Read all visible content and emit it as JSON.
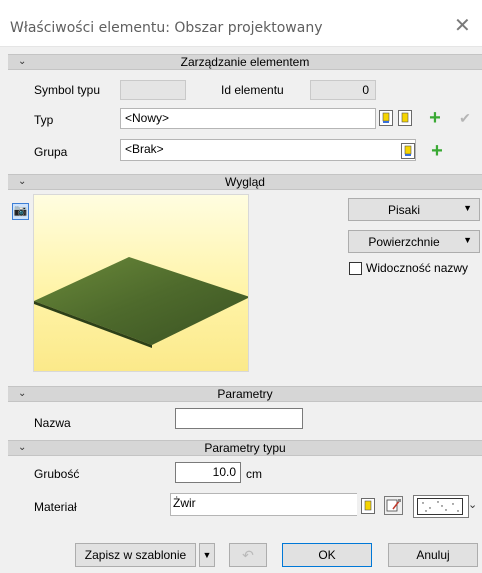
{
  "window": {
    "title": "Właściwości elementu: Obszar projektowany",
    "close_icon": "close-icon"
  },
  "sections": {
    "zarzadzanie": "Zarządzanie elementem",
    "wyglad": "Wygląd",
    "parametry": "Parametry",
    "parametry_typu": "Parametry typu"
  },
  "element": {
    "symbol_label": "Symbol typu",
    "symbol_value": "",
    "id_label": "Id elementu",
    "id_value": "0",
    "typ_label": "Typ",
    "typ_value": "<Nowy>",
    "grupa_label": "Grupa",
    "grupa_value": "<Brak>"
  },
  "wyglad": {
    "pisaki_label": "Pisaki",
    "powierzchnie_label": "Powierzchnie",
    "widocznosc_label": "Widoczność nazwy",
    "widocznosc_checked": false
  },
  "parametry": {
    "nazwa_label": "Nazwa",
    "nazwa_value": ""
  },
  "parametry_typu": {
    "grubosc_label": "Grubość",
    "grubosc_value": "10.0",
    "grubosc_unit": "cm",
    "material_label": "Materiał",
    "material_value": "Żwir"
  },
  "footer": {
    "zapisz_label": "Zapisz w szablonie",
    "ok_label": "OK",
    "anuluj_label": "Anuluj"
  },
  "colors": {
    "accent": "#0078d7",
    "plus_green": "#3aa934",
    "preview_grass": "#4e6a2c"
  }
}
